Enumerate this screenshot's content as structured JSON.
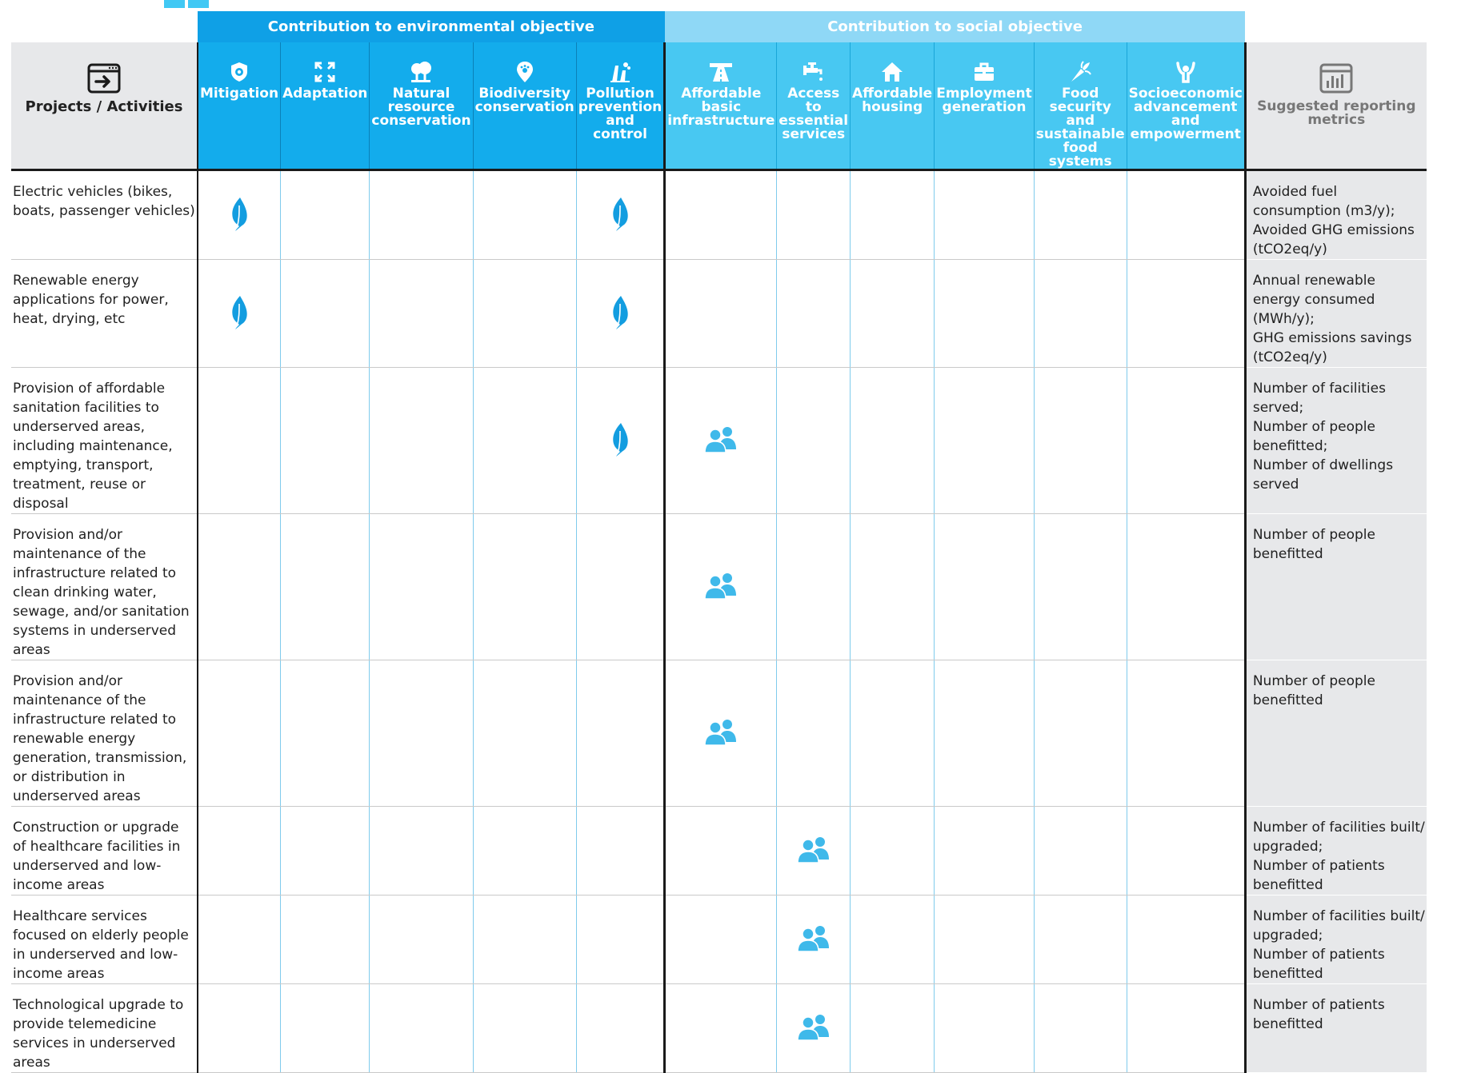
{
  "header": {
    "env_group": "Contribution to environmental objective",
    "soc_group": "Contribution to social objective",
    "projects_label": "Projects / Activities",
    "metrics_label": "Suggested reporting metrics"
  },
  "columns": [
    {
      "label": "Mitigation",
      "icon": "shield-icon",
      "group": "env"
    },
    {
      "label": "Adaptation",
      "icon": "expand-arrows-icon",
      "group": "env"
    },
    {
      "label": "Natural resource conservation",
      "icon": "trees-icon",
      "group": "env"
    },
    {
      "label": "Biodiversity conservation",
      "icon": "paw-pin-icon",
      "group": "env"
    },
    {
      "label": "Pollution prevention and control",
      "icon": "factory-icon",
      "group": "env"
    },
    {
      "label": "Affordable basic infrastructure",
      "icon": "road-icon",
      "group": "soc"
    },
    {
      "label": "Access to essential services",
      "icon": "water-tap-icon",
      "group": "soc"
    },
    {
      "label": "Affordable housing",
      "icon": "house-icon",
      "group": "soc"
    },
    {
      "label": "Employment generation",
      "icon": "briefcase-icon",
      "group": "soc"
    },
    {
      "label": "Food security and sustainable food systems",
      "icon": "carrot-icon",
      "group": "soc"
    },
    {
      "label": "Socioeconomic advancement and empowerment",
      "icon": "person-raised-arms-icon",
      "group": "soc"
    }
  ],
  "rows": [
    {
      "project": "Electric vehicles (bikes, boats, passenger vehicles)",
      "marks": [
        1,
        0,
        0,
        0,
        1,
        0,
        0,
        0,
        0,
        0,
        0
      ],
      "metrics": [
        "Avoided fuel",
        "consumption (m3/y);",
        "Avoided GHG emissions",
        "(tCO2eq/y)"
      ]
    },
    {
      "project": "Renewable energy applications for power, heat, drying, etc",
      "marks": [
        1,
        0,
        0,
        0,
        1,
        0,
        0,
        0,
        0,
        0,
        0
      ],
      "metrics": [
        "Annual renewable",
        "energy consumed",
        "(MWh/y);",
        "GHG emissions savings",
        "(tCO2eq/y)"
      ]
    },
    {
      "project": "Provision of affordable sanitation facilities to underserved areas, including maintenance, emptying, transport, treatment, reuse or disposal",
      "marks": [
        0,
        0,
        0,
        0,
        1,
        2,
        0,
        0,
        0,
        0,
        0
      ],
      "metrics": [
        "Number of facilities",
        "served;",
        "Number of people",
        "benefitted;",
        "Number of dwellings",
        "served"
      ]
    },
    {
      "project": "Provision and/or maintenance of the infrastructure related to clean drinking water, sewage, and/or sanitation systems in underserved areas",
      "marks": [
        0,
        0,
        0,
        0,
        0,
        2,
        0,
        0,
        0,
        0,
        0
      ],
      "metrics": [
        "Number of people",
        "benefitted"
      ]
    },
    {
      "project": "Provision and/or maintenance of the infrastructure related to renewable energy generation, transmission, or distribution in underserved areas",
      "marks": [
        0,
        0,
        0,
        0,
        0,
        2,
        0,
        0,
        0,
        0,
        0
      ],
      "metrics": [
        "Number of people",
        "benefitted"
      ]
    },
    {
      "project": "Construction or upgrade of healthcare facilities in underserved and low-income areas",
      "marks": [
        0,
        0,
        0,
        0,
        0,
        0,
        2,
        0,
        0,
        0,
        0
      ],
      "metrics": [
        "Number of facilities built/",
        "upgraded;",
        "Number of patients",
        "benefitted"
      ]
    },
    {
      "project": "Healthcare services focused on elderly people in underserved and low-income areas",
      "marks": [
        0,
        0,
        0,
        0,
        0,
        0,
        2,
        0,
        0,
        0,
        0
      ],
      "metrics": [
        "Number of facilities built/",
        "upgraded;",
        "Number of patients",
        "benefitted"
      ]
    },
    {
      "project": "Technological upgrade to provide telemedicine services in underserved areas",
      "marks": [
        0,
        0,
        0,
        0,
        0,
        0,
        2,
        0,
        0,
        0,
        0
      ],
      "metrics": [
        "Number of patients",
        "benefitted"
      ]
    }
  ],
  "colors": {
    "env_dark": "#0fa0e6",
    "soc_light": "#8fd8f6",
    "leaf": "#139de0",
    "people": "#3fb9ea"
  }
}
